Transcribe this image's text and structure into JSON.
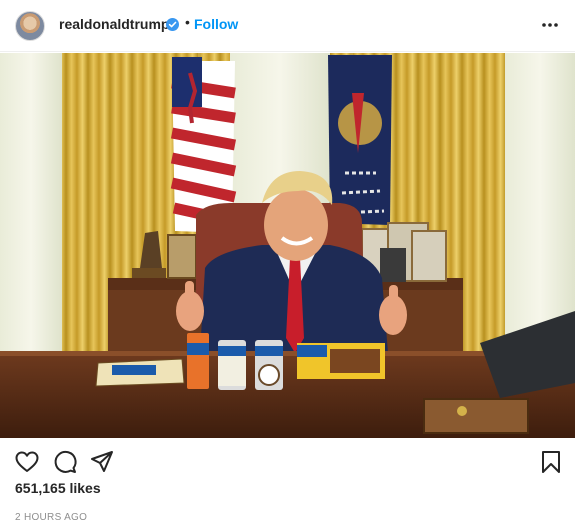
{
  "post": {
    "username": "realdonaldtrump",
    "separator": "•",
    "follow_label": "Follow",
    "likes": "651,165 likes",
    "timestamp": "2 HOURS AGO"
  },
  "icons": {
    "avatar": "profile-photo",
    "verified": "verified-badge-icon",
    "more": "more-options-icon",
    "like": "heart-icon",
    "comment": "comment-bubble-icon",
    "share": "paper-plane-icon",
    "save": "bookmark-icon"
  },
  "colors": {
    "accent": "#0095f6",
    "text": "#262626",
    "muted": "#8e8e8e"
  }
}
